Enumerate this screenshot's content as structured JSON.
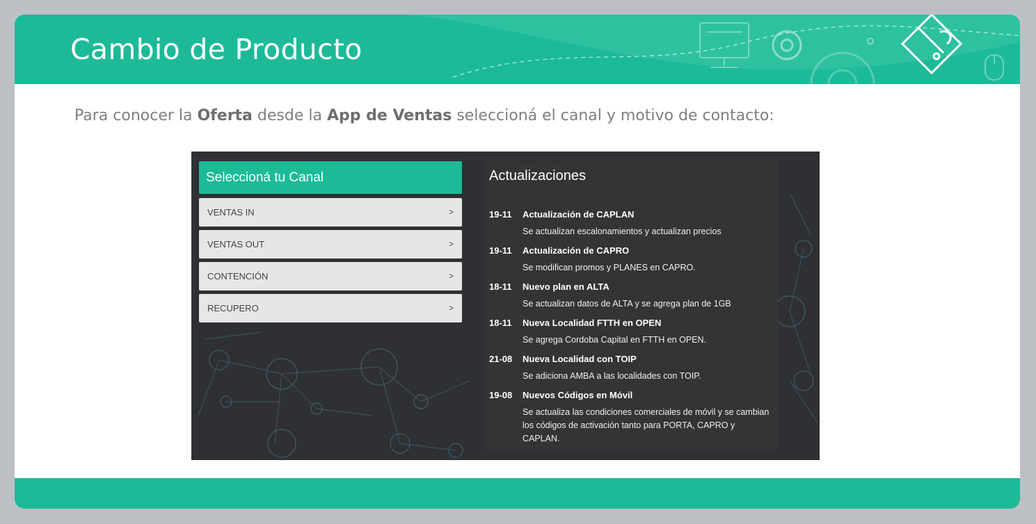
{
  "header": {
    "title": "Cambio de Producto"
  },
  "intro": {
    "part1": "Para conocer la ",
    "bold1": "Oferta",
    "part2": " desde la ",
    "bold2": "App de Ventas",
    "part3": " seleccioná el canal y motivo de contacto:"
  },
  "app": {
    "canal_title": "Seleccioná tu Canal",
    "canal_items": [
      {
        "label": "VENTAS IN",
        "arrow": ">"
      },
      {
        "label": "VENTAS OUT",
        "arrow": ">"
      },
      {
        "label": "CONTENCIÓN",
        "arrow": ">"
      },
      {
        "label": "RECUPERO",
        "arrow": ">"
      }
    ],
    "updates_title": "Actualizaciones",
    "updates": [
      {
        "date": "19-11",
        "title": "Actualización de CAPLAN",
        "desc": "Se actualizan escalonamientos y actualizan precios"
      },
      {
        "date": "19-11",
        "title": "Actualización de CAPRO",
        "desc": "Se modifican promos y PLANES en CAPRO."
      },
      {
        "date": "18-11",
        "title": "Nuevo plan en ALTA",
        "desc": "Se actualizan datos de ALTA y se agrega plan de 1GB"
      },
      {
        "date": "18-11",
        "title": "Nueva Localidad FTTH en OPEN",
        "desc": "Se agrega Cordoba Capital en FTTH en OPEN."
      },
      {
        "date": "21-08",
        "title": "Nueva Localidad con TOIP",
        "desc": "Se adiciona AMBA a las localidades con TOIP."
      },
      {
        "date": "19-08",
        "title": "Nuevos Códigos en Móvil",
        "desc": "Se actualiza las condiciones comerciales de móvil y se cambian los códigos de activación tanto para PORTA, CAPRO y CAPLAN."
      }
    ]
  },
  "colors": {
    "accent": "#1dba98",
    "app_bg": "#2e3033",
    "frame": "#bcc0c4"
  }
}
